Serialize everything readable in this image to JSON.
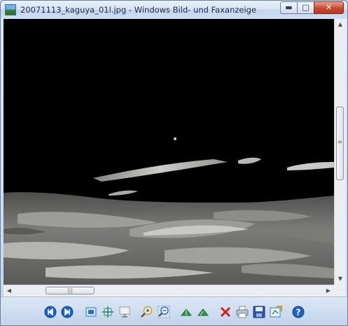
{
  "window": {
    "title": "20071113_kaguya_01l.jpg - Windows Bild- und Faxanzeige",
    "icon": "photo-viewer-icon"
  },
  "caption_buttons": {
    "minimize": "minimize-icon",
    "maximize": "maximize-icon",
    "close": "close-icon"
  },
  "image": {
    "description_icon": "lunar-surface-image",
    "background_color": "#000000",
    "surface_color": "#7d7d7b"
  },
  "scrollbars": {
    "vertical_position": 0.42,
    "horizontal_position": 0.16
  },
  "toolbar": {
    "buttons": [
      {
        "icon": "previous-image-icon",
        "accent": "#1a64c8"
      },
      {
        "icon": "next-image-icon",
        "accent": "#1a64c8"
      },
      {
        "icon": "best-fit-icon",
        "accent": "#2b73c4"
      },
      {
        "icon": "actual-size-icon",
        "accent": "#2f9a44"
      },
      {
        "icon": "slideshow-icon",
        "accent": "#9a9a9a"
      },
      {
        "icon": "zoom-in-icon",
        "accent": "#d79a1a"
      },
      {
        "icon": "zoom-out-icon",
        "accent": "#2b73c4"
      },
      {
        "icon": "rotate-clockwise-icon",
        "accent": "#2f9a44"
      },
      {
        "icon": "rotate-counterclockwise-icon",
        "accent": "#2f9a44"
      },
      {
        "icon": "delete-icon",
        "accent": "#d0201e"
      },
      {
        "icon": "print-icon",
        "accent": "#7d8a99"
      },
      {
        "icon": "save-icon",
        "accent": "#2b57a8"
      },
      {
        "icon": "open-with-icon",
        "accent": "#3a7cc0"
      },
      {
        "icon": "help-icon",
        "accent": "#1a64c8"
      }
    ]
  }
}
